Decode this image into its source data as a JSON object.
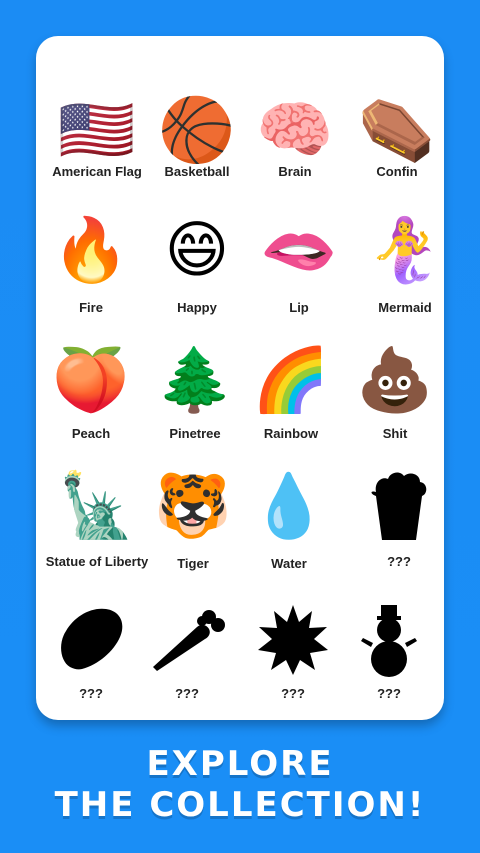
{
  "collection": {
    "items": [
      {
        "label": "American Flag",
        "icon": "american-flag-icon"
      },
      {
        "label": "Basketball",
        "icon": "basketball-icon"
      },
      {
        "label": "Brain",
        "icon": "brain-icon"
      },
      {
        "label": "Confin",
        "icon": "coffin-icon"
      },
      {
        "label": "Fire",
        "icon": "fire-icon"
      },
      {
        "label": "Happy",
        "icon": "happy-face-icon"
      },
      {
        "label": "Lip",
        "icon": "lip-icon"
      },
      {
        "label": "Mermaid",
        "icon": "mermaid-icon"
      },
      {
        "label": "Peach",
        "icon": "peach-icon"
      },
      {
        "label": "Pinetree",
        "icon": "pine-tree-icon"
      },
      {
        "label": "Rainbow",
        "icon": "rainbow-icon"
      },
      {
        "label": "Shit",
        "icon": "poop-icon"
      },
      {
        "label": "Statue of Liberty",
        "icon": "statue-of-liberty-icon"
      },
      {
        "label": "Tiger",
        "icon": "tiger-icon"
      },
      {
        "label": "Water",
        "icon": "water-drop-icon"
      },
      {
        "label": "???",
        "icon": "locked-silhouette-popcorn-icon"
      },
      {
        "label": "???",
        "icon": "locked-silhouette-potato-icon"
      },
      {
        "label": "???",
        "icon": "locked-silhouette-carrot-icon"
      },
      {
        "label": "???",
        "icon": "locked-silhouette-burst-icon"
      },
      {
        "label": "???",
        "icon": "locked-silhouette-snowman-icon"
      }
    ]
  },
  "headline": {
    "line1": "EXPLORE",
    "line2": "THE COLLECTION!"
  },
  "colors": {
    "background": "#1e8ff5",
    "card": "#ffffff",
    "label": "#222222",
    "headline": "#ffffff"
  }
}
